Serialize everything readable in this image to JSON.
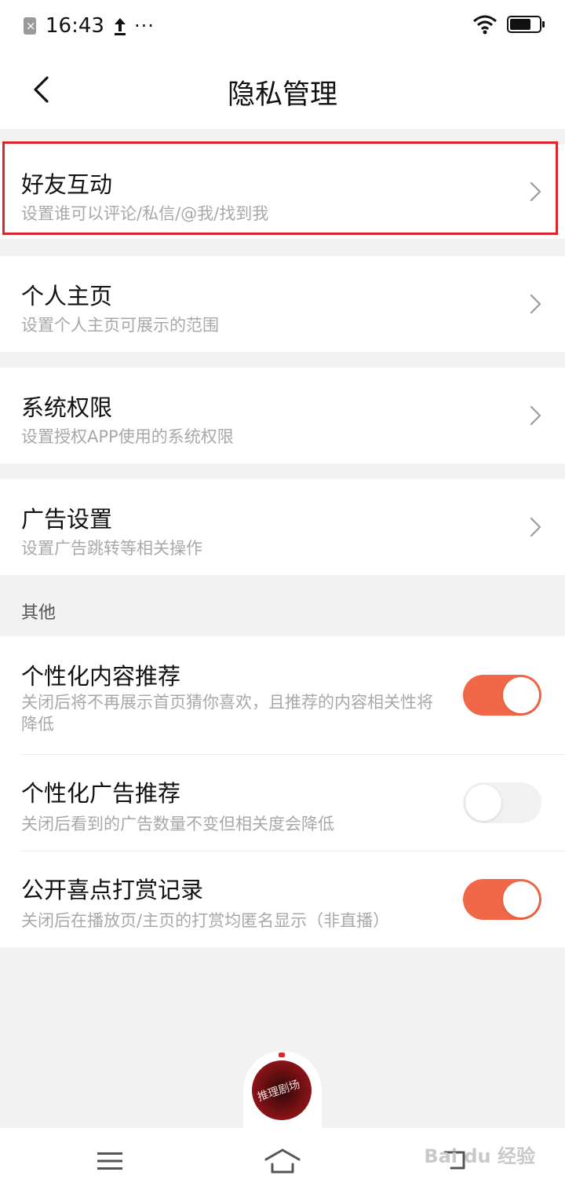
{
  "status_bar": {
    "time": "16:43",
    "more": "···"
  },
  "header": {
    "title": "隐私管理"
  },
  "menu_items": [
    {
      "title": "好友互动",
      "subtitle": "设置谁可以评论/私信/@我/找到我"
    },
    {
      "title": "个人主页",
      "subtitle": "设置个人主页可展示的范围"
    },
    {
      "title": "系统权限",
      "subtitle": "设置授权APP使用的系统权限"
    },
    {
      "title": "广告设置",
      "subtitle": "设置广告跳转等相关操作"
    }
  ],
  "other_section": {
    "label": "其他",
    "toggles": [
      {
        "title": "个性化内容推荐",
        "subtitle": "关闭后将不再展示首页猜你喜欢，且推荐的内容相关性将降低",
        "on": true
      },
      {
        "title": "个性化广告推荐",
        "subtitle": "关闭后看到的广告数量不变但相关度会降低",
        "on": false
      },
      {
        "title": "公开喜点打赏记录",
        "subtitle": "关闭后在播放页/主页的打赏均匿名显示（非直播）",
        "on": true
      }
    ]
  },
  "player": {
    "cover_text": "推理剧场"
  },
  "watermark": "Bai du 经验",
  "colors": {
    "accent": "#f26747",
    "highlight": "#d8262c",
    "background": "#f2f2f2"
  }
}
